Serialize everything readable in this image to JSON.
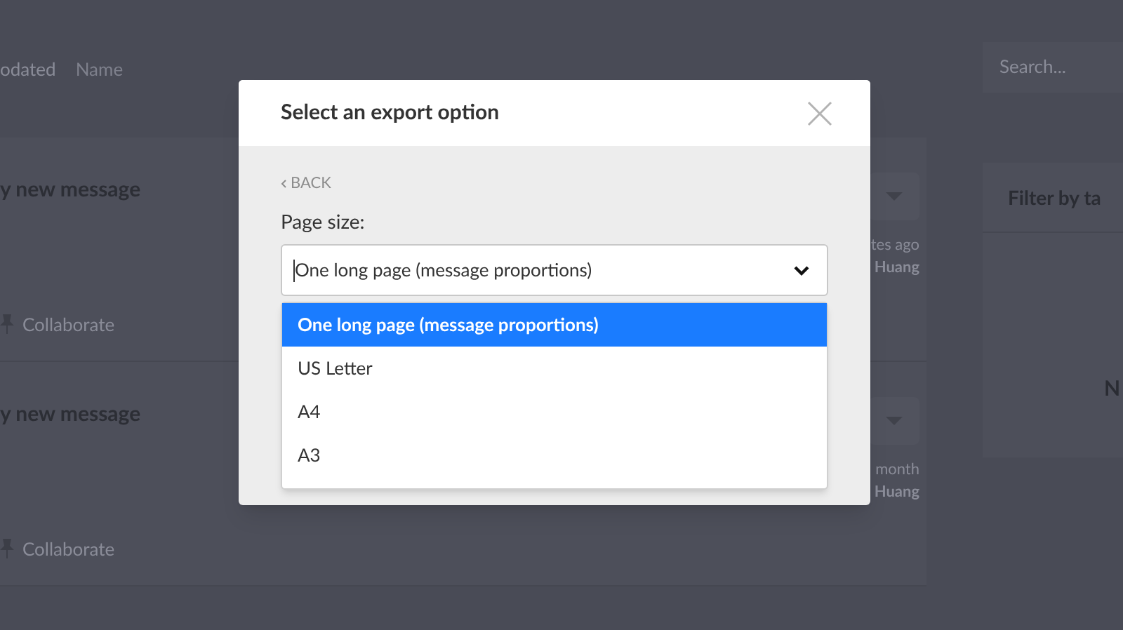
{
  "background": {
    "sort_options": [
      "odated",
      "Name"
    ],
    "search": {
      "placeholder": "Search..."
    },
    "cards": [
      {
        "title": "y new message",
        "time": "tes ago",
        "author": "Huang",
        "action": "Collaborate"
      },
      {
        "title": "y new message",
        "time": "month",
        "author": "Huang",
        "action": "Collaborate"
      }
    ],
    "sidebar": {
      "filter_title": "Filter by ta",
      "panel_text": "N"
    }
  },
  "dialog": {
    "title": "Select an export option",
    "back": "BACK",
    "field_label": "Page size:",
    "value": "One long page (message proportions)",
    "options": [
      {
        "label": "One long page (message proportions)",
        "selected": true
      },
      {
        "label": "US Letter",
        "selected": false
      },
      {
        "label": "A4",
        "selected": false
      },
      {
        "label": "A3",
        "selected": false
      }
    ]
  }
}
